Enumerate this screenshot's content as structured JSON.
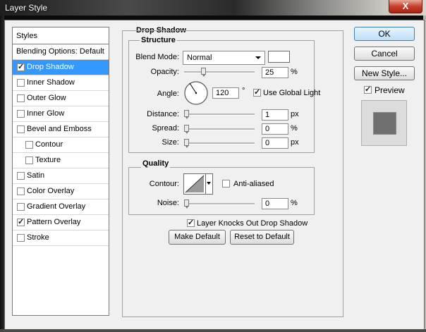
{
  "window": {
    "title": "Layer Style",
    "close_label": "X"
  },
  "styles": {
    "header": "Styles",
    "items": [
      {
        "label": "Blending Options: Default",
        "has_checkbox": false,
        "checked": false,
        "indent": false,
        "selected": false
      },
      {
        "label": "Drop Shadow",
        "has_checkbox": true,
        "checked": true,
        "indent": false,
        "selected": true
      },
      {
        "label": "Inner Shadow",
        "has_checkbox": true,
        "checked": false,
        "indent": false,
        "selected": false
      },
      {
        "label": "Outer Glow",
        "has_checkbox": true,
        "checked": false,
        "indent": false,
        "selected": false
      },
      {
        "label": "Inner Glow",
        "has_checkbox": true,
        "checked": false,
        "indent": false,
        "selected": false
      },
      {
        "label": "Bevel and Emboss",
        "has_checkbox": true,
        "checked": false,
        "indent": false,
        "selected": false
      },
      {
        "label": "Contour",
        "has_checkbox": true,
        "checked": false,
        "indent": true,
        "selected": false
      },
      {
        "label": "Texture",
        "has_checkbox": true,
        "checked": false,
        "indent": true,
        "selected": false
      },
      {
        "label": "Satin",
        "has_checkbox": true,
        "checked": false,
        "indent": false,
        "selected": false
      },
      {
        "label": "Color Overlay",
        "has_checkbox": true,
        "checked": false,
        "indent": false,
        "selected": false
      },
      {
        "label": "Gradient Overlay",
        "has_checkbox": true,
        "checked": false,
        "indent": false,
        "selected": false
      },
      {
        "label": "Pattern Overlay",
        "has_checkbox": true,
        "checked": true,
        "indent": false,
        "selected": false
      },
      {
        "label": "Stroke",
        "has_checkbox": true,
        "checked": false,
        "indent": false,
        "selected": false
      }
    ]
  },
  "drop_shadow": {
    "section_title": "Drop Shadow",
    "structure": {
      "title": "Structure",
      "blend_mode_label": "Blend Mode:",
      "blend_mode_value": "Normal",
      "shadow_color": "#ffffff",
      "opacity_label": "Opacity:",
      "opacity_value": "25",
      "opacity_unit": "%",
      "angle_label": "Angle:",
      "angle_value": "120",
      "angle_unit": "°",
      "use_global_light_label": "Use Global Light",
      "use_global_light_checked": true,
      "distance_label": "Distance:",
      "distance_value": "1",
      "distance_unit": "px",
      "spread_label": "Spread:",
      "spread_value": "0",
      "spread_unit": "%",
      "size_label": "Size:",
      "size_value": "0",
      "size_unit": "px"
    },
    "quality": {
      "title": "Quality",
      "contour_label": "Contour:",
      "anti_aliased_label": "Anti-aliased",
      "anti_aliased_checked": false,
      "noise_label": "Noise:",
      "noise_value": "0",
      "noise_unit": "%"
    },
    "knockout_label": "Layer Knocks Out Drop Shadow",
    "knockout_checked": true,
    "make_default_label": "Make Default",
    "reset_default_label": "Reset to Default"
  },
  "actions": {
    "ok_label": "OK",
    "cancel_label": "Cancel",
    "new_style_label": "New Style...",
    "preview_label": "Preview",
    "preview_checked": true
  },
  "colors": {
    "selection": "#3399ff",
    "ok_border": "#3c7fb1"
  }
}
